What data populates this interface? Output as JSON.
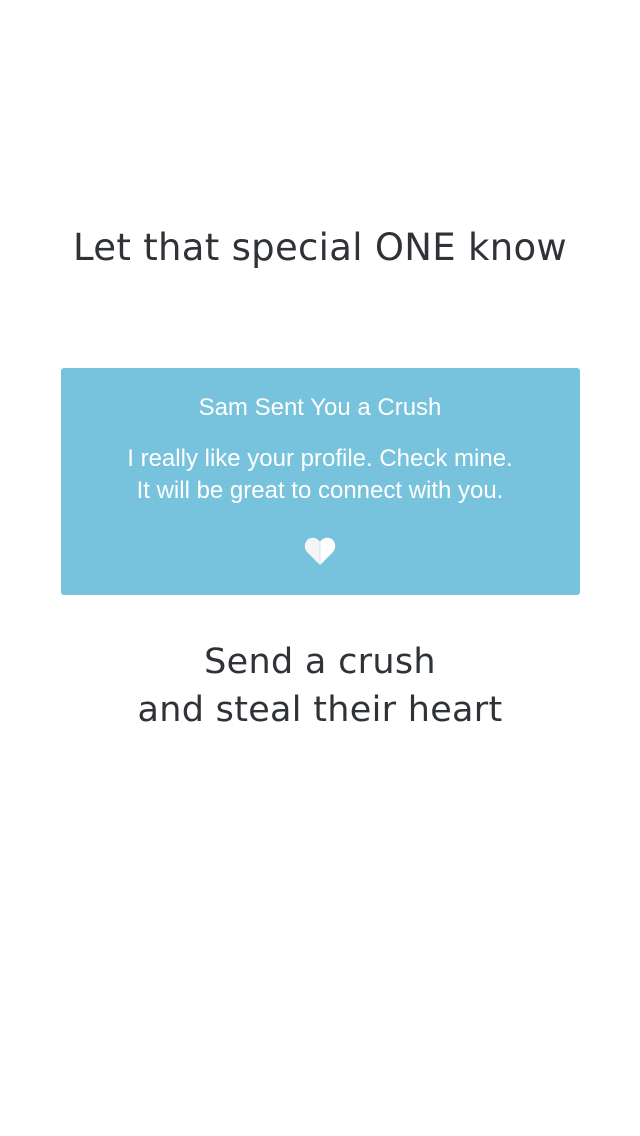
{
  "headline": "Let that special ONE know",
  "card": {
    "title": "Sam Sent You a Crush",
    "message_line1": "I really like your profile. Check mine.",
    "message_line2": "It will be great to connect with you.",
    "icon": "heart-icon",
    "background_color": "#77c2dc"
  },
  "tagline": {
    "line1": "Send a crush",
    "line2": "and steal their heart"
  }
}
